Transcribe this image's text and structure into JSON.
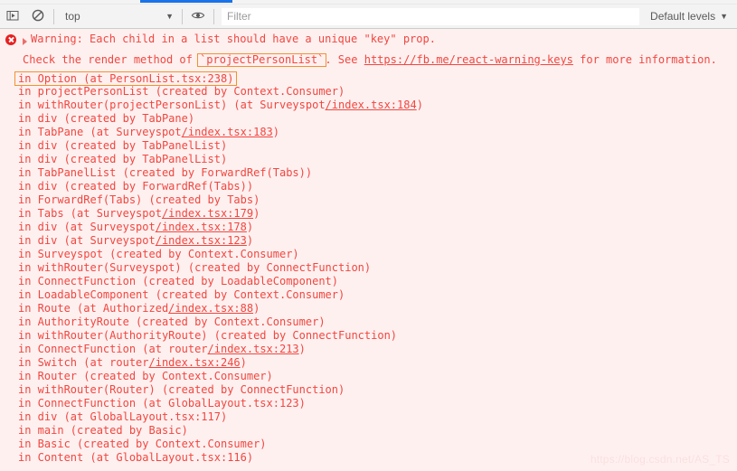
{
  "tabstrip": {
    "active_tab_accent": "#1a73e8"
  },
  "toolbar": {
    "sidebar_toggle_icon": "panel-toggle-icon",
    "clear_console_icon": "clear-console-icon",
    "context_selector": {
      "value": "top",
      "caret": "▼"
    },
    "live_expression_icon": "eye-icon",
    "filter": {
      "value": "",
      "placeholder": "Filter"
    },
    "levels": {
      "label": "Default levels",
      "caret": "▼"
    }
  },
  "console": {
    "background": "#fff0f0",
    "text_color": "#f0473f",
    "highlight_border": "#f0922f",
    "message": {
      "severity": "error",
      "expanded": false,
      "line1_pre": "Warning: Each child in a list should have a unique ",
      "line1_key": "\"key\"",
      "line1_post": " prop.",
      "line2_pre": "Check the render method of ",
      "line2_component": "`projectPersonList`",
      "line2_mid": ". See ",
      "line2_link": "https://fb.me/react-warning-keys",
      "line2_post": " for more information."
    },
    "stack": [
      {
        "text": "in Option (at PersonList.tsx:238)",
        "highlighted": true,
        "link": ""
      },
      {
        "text": "in projectPersonList (created by Context.Consumer)",
        "highlighted": false,
        "link": ""
      },
      {
        "text": "in withRouter(projectPersonList) (at Surveyspot",
        "highlighted": false,
        "link": "/index.tsx:184",
        "tail": ")"
      },
      {
        "text": "in div (created by TabPane)",
        "highlighted": false,
        "link": ""
      },
      {
        "text": "in TabPane (at Surveyspot",
        "highlighted": false,
        "link": "/index.tsx:183",
        "tail": ")"
      },
      {
        "text": "in div (created by TabPanelList)",
        "highlighted": false,
        "link": ""
      },
      {
        "text": "in div (created by TabPanelList)",
        "highlighted": false,
        "link": ""
      },
      {
        "text": "in TabPanelList (created by ForwardRef(Tabs))",
        "highlighted": false,
        "link": ""
      },
      {
        "text": "in div (created by ForwardRef(Tabs))",
        "highlighted": false,
        "link": ""
      },
      {
        "text": "in ForwardRef(Tabs) (created by Tabs)",
        "highlighted": false,
        "link": ""
      },
      {
        "text": "in Tabs (at Surveyspot",
        "highlighted": false,
        "link": "/index.tsx:179",
        "tail": ")"
      },
      {
        "text": "in div (at Surveyspot",
        "highlighted": false,
        "link": "/index.tsx:178",
        "tail": ")"
      },
      {
        "text": "in div (at Surveyspot",
        "highlighted": false,
        "link": "/index.tsx:123",
        "tail": ")"
      },
      {
        "text": "in Surveyspot (created by Context.Consumer)",
        "highlighted": false,
        "link": ""
      },
      {
        "text": "in withRouter(Surveyspot) (created by ConnectFunction)",
        "highlighted": false,
        "link": ""
      },
      {
        "text": "in ConnectFunction (created by LoadableComponent)",
        "highlighted": false,
        "link": ""
      },
      {
        "text": "in LoadableComponent (created by Context.Consumer)",
        "highlighted": false,
        "link": ""
      },
      {
        "text": "in Route (at Authorized",
        "highlighted": false,
        "link": "/index.tsx:88",
        "tail": ")"
      },
      {
        "text": "in AuthorityRoute (created by Context.Consumer)",
        "highlighted": false,
        "link": ""
      },
      {
        "text": "in withRouter(AuthorityRoute) (created by ConnectFunction)",
        "highlighted": false,
        "link": ""
      },
      {
        "text": "in ConnectFunction (at router",
        "highlighted": false,
        "link": "/index.tsx:213",
        "tail": ")"
      },
      {
        "text": "in Switch (at router",
        "highlighted": false,
        "link": "/index.tsx:246",
        "tail": ")"
      },
      {
        "text": "in Router (created by Context.Consumer)",
        "highlighted": false,
        "link": ""
      },
      {
        "text": "in withRouter(Router) (created by ConnectFunction)",
        "highlighted": false,
        "link": ""
      },
      {
        "text": "in ConnectFunction (at GlobalLayout.tsx:123)",
        "highlighted": false,
        "link": ""
      },
      {
        "text": "in div (at GlobalLayout.tsx:117)",
        "highlighted": false,
        "link": ""
      },
      {
        "text": "in main (created by Basic)",
        "highlighted": false,
        "link": ""
      },
      {
        "text": "in Basic (created by Context.Consumer)",
        "highlighted": false,
        "link": ""
      },
      {
        "text": "in Content (at GlobalLayout.tsx:116)",
        "highlighted": false,
        "link": ""
      }
    ]
  },
  "watermark": {
    "text": "https://blog.csdn.net/AS_TS"
  }
}
